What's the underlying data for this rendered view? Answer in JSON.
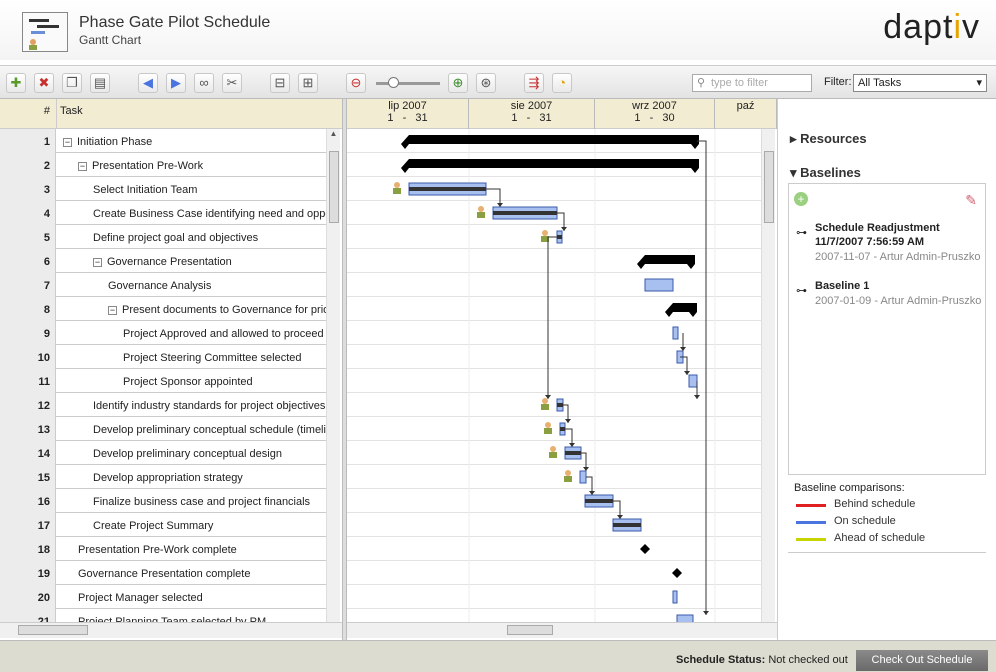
{
  "header": {
    "title": "Phase Gate Pilot Schedule",
    "subtitle": "Gantt Chart",
    "logo": "daptiv"
  },
  "toolbar": {
    "filter_placeholder": "type to filter",
    "filter_label": "Filter:",
    "filter_value": "All Tasks"
  },
  "grid": {
    "col_num": "#",
    "col_task": "Task",
    "rows": [
      {
        "num": "1",
        "name": "Initiation Phase",
        "toggle": "−"
      },
      {
        "num": "2",
        "name": "Presentation Pre-Work",
        "toggle": "−"
      },
      {
        "num": "3",
        "name": "Select Initiation Team"
      },
      {
        "num": "4",
        "name": "Create Business Case identifying need and opportunities"
      },
      {
        "num": "5",
        "name": "Define project goal and objectives"
      },
      {
        "num": "6",
        "name": "Governance Presentation",
        "toggle": "−"
      },
      {
        "num": "7",
        "name": "Governance Analysis"
      },
      {
        "num": "8",
        "name": "Present documents to Governance for prioritization",
        "toggle": "−"
      },
      {
        "num": "9",
        "name": "Project Approved and allowed to proceed"
      },
      {
        "num": "10",
        "name": "Project Steering Committee selected"
      },
      {
        "num": "11",
        "name": "Project Sponsor appointed"
      },
      {
        "num": "12",
        "name": "Identify industry standards for project objectives"
      },
      {
        "num": "13",
        "name": "Develop preliminary conceptual schedule (timeline)"
      },
      {
        "num": "14",
        "name": "Develop preliminary conceptual design"
      },
      {
        "num": "15",
        "name": "Develop appropriation strategy"
      },
      {
        "num": "16",
        "name": "Finalize business case and project financials"
      },
      {
        "num": "17",
        "name": "Create Project Summary"
      },
      {
        "num": "18",
        "name": "Presentation Pre-Work complete"
      },
      {
        "num": "19",
        "name": "Governance Presentation complete"
      },
      {
        "num": "20",
        "name": "Project Manager selected"
      },
      {
        "num": "21",
        "name": "Project Planning Team selected by PM"
      }
    ]
  },
  "timeline": {
    "months": [
      {
        "label": "lip 2007",
        "days": "1   -   31"
      },
      {
        "label": "sie 2007",
        "days": "1   -   31"
      },
      {
        "label": "wrz 2007",
        "days": "1   -   30"
      },
      {
        "label": "paź",
        "days": ""
      }
    ]
  },
  "panel": {
    "resources_title": "Resources",
    "baselines_title": "Baselines",
    "baselines": [
      {
        "name": "Schedule Readjustment 11/7/2007 7:56:59 AM",
        "name1": "Schedule Readjustment",
        "name2": "11/7/2007 7:56:59 AM",
        "date": "2007-11-07",
        "author": "Artur Admin-Pruszko"
      },
      {
        "name": "Baseline 1",
        "date": "2007-01-09",
        "author": "Artur Admin-Pruszko"
      }
    ],
    "comparisons_title": "Baseline comparisons:",
    "legend": [
      {
        "label": "Behind schedule",
        "color": "#e02020"
      },
      {
        "label": "On schedule",
        "color": "#4a74e0"
      },
      {
        "label": "Ahead of schedule",
        "color": "#c8d400"
      }
    ]
  },
  "footer": {
    "status_label": "Schedule Status:",
    "status_value": "Not checked out",
    "checkout_button": "Check Out Schedule"
  }
}
